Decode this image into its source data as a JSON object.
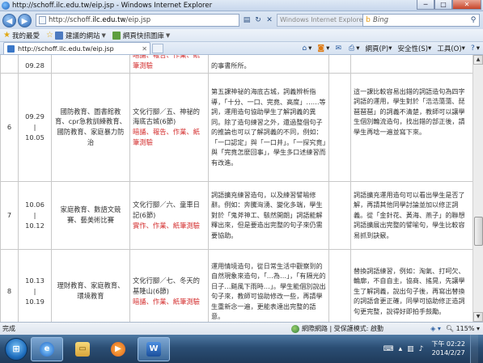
{
  "window": {
    "title": "http://schoff.ilc.edu.tw/eip.jsp - Windows Internet Explorer",
    "minimize": "─",
    "maximize": "□",
    "close": "✕"
  },
  "address": {
    "url_prefix": "http://schoff.",
    "url_domain": "ilc.edu.tw",
    "url_path": "/eip.jsp",
    "dim_title": "Windows Internet Explorer",
    "search_placeholder": "Bing"
  },
  "favorites": {
    "items": [
      {
        "label": "我的最愛",
        "icon": "star-icon"
      },
      {
        "label": "建議的網站",
        "icon": "ie-icon"
      },
      {
        "label": "網頁快訊圖庫",
        "icon": "webslice-icon"
      }
    ]
  },
  "tab": {
    "label": "http://schoff.ilc.edu.tw/eip.jsp"
  },
  "commands": {
    "page": "網頁(P)",
    "safety": "安全性(S)",
    "tools": "工具(O)",
    "help": "?"
  },
  "table": {
    "top_row": {
      "date": "09.28",
      "unit_red": "暗誦、報告、作業、紙筆測驗",
      "goal": "的事書所所。"
    },
    "rows": [
      {
        "num": "6",
        "date_start": "09.29",
        "date_sep": "|",
        "date_end": "10.05",
        "topic": "國防教育、圖書館教育、cpr急救訓練教育、國防教育、家庭暴力防治",
        "unit": "文化行腳／五、神祕的海底古城(6節)",
        "unit_red": "暗誦、報告、作業、紙筆測驗",
        "goal": "第五課神祕的海底古城，詞義辨析指導，「十分、一口、完竟、高度」……等詞，運用造句協助學生了解詞義的異同。除了造句練習之外，還過整個句子的推論也可以了解詞義的不同，例如：「一口認定」與「一口井」。「一探究竟」與「完竟怎麼回事」，學生多口述練習而有改進。",
        "eval": "這一課比較容易出錯的詞語造句為四字詞語的運用，學生對於「浩浩蕩蕩、琵琶琶琶」的詞義不清楚，教師可以讓學生個別輪流造句，找出錯的部正後，請學生再唸一遍並寫下來。"
      },
      {
        "num": "7",
        "date_start": "10.06",
        "date_sep": "|",
        "date_end": "10.12",
        "topic": "家庭教育、數語文競賽、藝美術比賽",
        "unit": "文化行腳／六、童車日記(6節)",
        "unit_red": "實作、作業、紙筆測驗",
        "goal": "詞語擴充練習造句，以及練習譬喻修辭。例如：奔騰洶湧、變化多端，學生對於「鬼斧神工、駭然開朗」詞語能解釋出來，但是要造出完整的句子來仍需要協助。",
        "eval": "詞語擴充運用造句可以看出學生是否了解，再請其他同學討論並加以修正詞義。從「金針花、黃海、燕子」的聯想詞語擴展出完整的譬喻句，學生比較容易抓到訣竅。"
      },
      {
        "num": "8",
        "date_start": "10.13",
        "date_sep": "|",
        "date_end": "10.19",
        "topic": "理財教育、家庭教育、環境教育",
        "unit": "文化行腳／七、冬天的基隆山(6節)",
        "unit_red": "暗誦、作業、紙筆測驗",
        "goal": "運用情境造句，從日常生活中觀察到的自然現象來造句，「…為…」，「有隔光的日子…颳風下雨時…」。學生能個別說出句子來，教師可協助修改一些，再請學生重新念一遍，更能表達出完整的語意。",
        "eval": "替換詞語練習，例如：淘氣、打呵欠、輪廓，不自自主，協商、搖晃，先讓學生了解詞義，說出句子後，再寫出替換的詞語會更正確，同學可協助修正造詞句更完整，說得好即拍手鼓勵。"
      }
    ]
  },
  "status": {
    "done": "完成",
    "zone": "網際網路 | 受保護模式: 啟動",
    "zoom": "115%"
  },
  "taskbar": {
    "start": "⊞",
    "clock_time": "下午 02:22",
    "clock_date": "2014/2/27"
  }
}
